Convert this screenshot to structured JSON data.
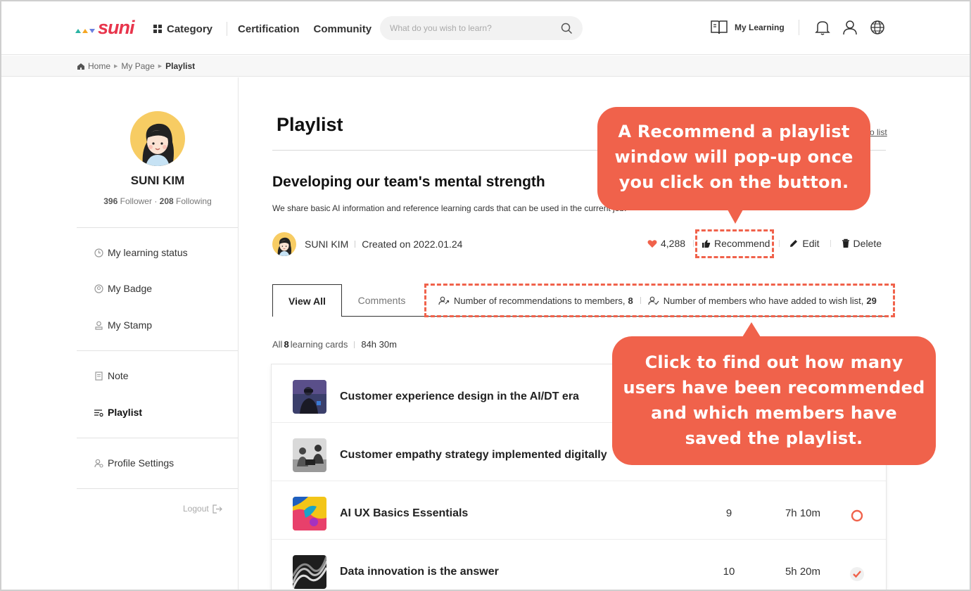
{
  "colors": {
    "brand": "#e8354c",
    "accent": "#f0624b",
    "heart": "#f0624b"
  },
  "header": {
    "logo": "suni",
    "nav": [
      "Category",
      "Certification",
      "Community"
    ],
    "search_placeholder": "What do you wish to learn?",
    "my_learning": "My Learning",
    "icons": [
      "bell-icon",
      "user-icon",
      "globe-icon"
    ]
  },
  "breadcrumb": [
    "Home",
    "My Page",
    "Playlist"
  ],
  "profile": {
    "name": "SUNI KIM",
    "followers": "396",
    "followers_label": "Follower",
    "following": "208",
    "following_label": "Following"
  },
  "sidebar": {
    "menu": [
      {
        "label": "My learning status",
        "icon": "clock-icon"
      },
      {
        "label": "My Badge",
        "icon": "badge-icon"
      },
      {
        "label": "My Stamp",
        "icon": "stamp-icon"
      },
      {
        "label": "Note",
        "icon": "note-icon"
      },
      {
        "label": "Playlist",
        "icon": "playlist-icon"
      },
      {
        "label": "Profile Settings",
        "icon": "settings-icon"
      }
    ],
    "logout": "Logout"
  },
  "main": {
    "title": "Playlist",
    "to_list": "To list",
    "playlist_title": "Developing our team's mental strength",
    "description": "We share basic AI information and reference learning cards that can be used in the current job.",
    "author": "SUNI KIM",
    "created": "Created on 2022.01.24",
    "likes": "4,288",
    "actions": {
      "recommend": "Recommend",
      "edit": "Edit",
      "delete": "Delete"
    },
    "tabs": [
      "View All",
      "Comments"
    ],
    "stats": {
      "recommendations_label": "Number of recommendations to members,",
      "recommendations_value": "8",
      "wishlist_label": "Number of members who have added to wish list,",
      "wishlist_value": "29"
    },
    "counts": {
      "prefix": "All",
      "number": "8",
      "suffix": "learning cards",
      "duration": "84h 30m"
    },
    "cards": [
      {
        "title": "Customer experience design in the AI/DT era",
        "count": "",
        "time": "",
        "status": ""
      },
      {
        "title": "Customer empathy strategy implemented digitally",
        "count": "",
        "time": "",
        "status": ""
      },
      {
        "title": "AI UX Basics Essentials",
        "count": "9",
        "time": "7h 10m",
        "status": "in-progress"
      },
      {
        "title": "Data innovation is the answer",
        "count": "10",
        "time": "5h 20m",
        "status": "completed"
      }
    ]
  },
  "callouts": {
    "recommend_lines": [
      "A Recommend a playlist",
      "window will pop-up once",
      "you click on the button."
    ],
    "stats_lines": [
      "Click to find out how many",
      "users have been recommended",
      "and which members have",
      "saved the playlist."
    ]
  }
}
